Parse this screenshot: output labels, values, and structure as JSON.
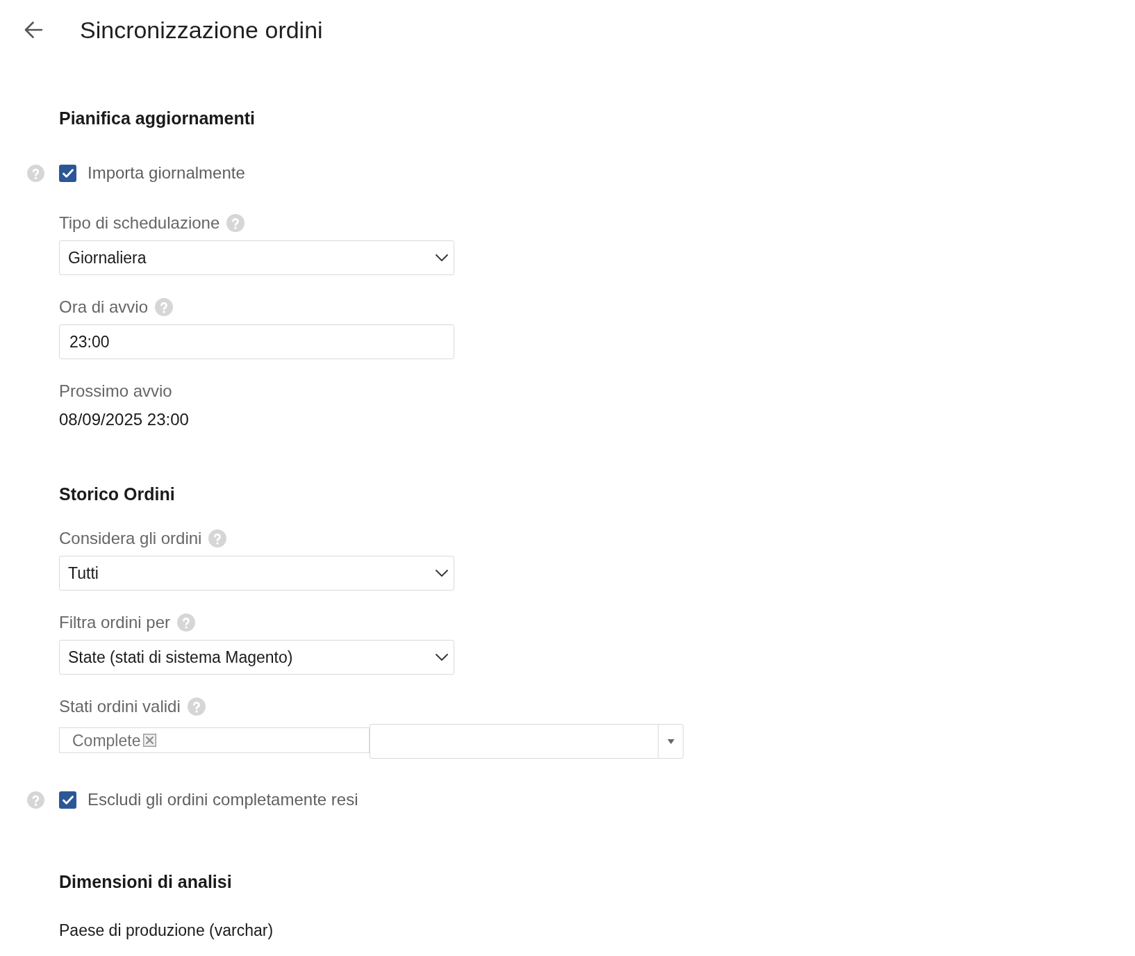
{
  "header": {
    "title": "Sincronizzazione ordini"
  },
  "sections": [
    {
      "heading": "Pianifica aggiornamenti",
      "items": [
        {
          "kind": "checkbox",
          "label": "Importa giornalmente",
          "checked": true,
          "help": true
        },
        {
          "kind": "select",
          "label": "Tipo di schedulazione",
          "value": "Giornaliera",
          "help": true
        },
        {
          "kind": "input",
          "label": "Ora di avvio",
          "value": "23:00",
          "help": true
        },
        {
          "kind": "info",
          "label": "Prossimo avvio",
          "value": "08/09/2025 23:00"
        }
      ]
    },
    {
      "heading": "Storico Ordini",
      "items": [
        {
          "kind": "select",
          "label": "Considera gli ordini",
          "value": "Tutti",
          "help": true
        },
        {
          "kind": "select",
          "label": "Filtra ordini per",
          "value": "State (stati di sistema Magento)",
          "help": true
        },
        {
          "kind": "multiselect",
          "label": "Stati ordini validi",
          "tags": [
            "Complete"
          ],
          "help": true
        },
        {
          "kind": "checkbox",
          "label": "Escludi gli ordini completamente resi",
          "checked": true,
          "help": true
        }
      ]
    },
    {
      "heading": "Dimensioni di analisi",
      "items": [
        {
          "kind": "text",
          "label": "Paese di produzione (varchar)"
        }
      ]
    }
  ]
}
